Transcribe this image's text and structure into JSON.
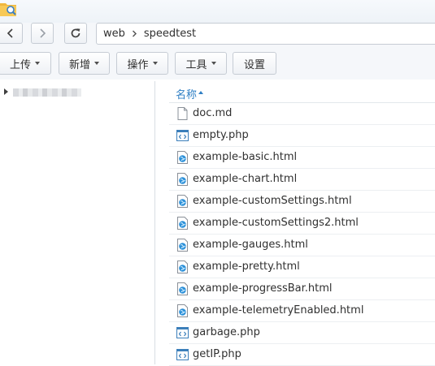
{
  "nav": {
    "path": [
      "web",
      "speedtest"
    ]
  },
  "toolbar": {
    "upload": "上传",
    "new": "新增",
    "action": "操作",
    "tools": "工具",
    "settings": "设置"
  },
  "list": {
    "column_name": "名称",
    "files": [
      {
        "name": "doc.md",
        "type": "document"
      },
      {
        "name": "empty.php",
        "type": "code"
      },
      {
        "name": "example-basic.html",
        "type": "web"
      },
      {
        "name": "example-chart.html",
        "type": "web"
      },
      {
        "name": "example-customSettings.html",
        "type": "web"
      },
      {
        "name": "example-customSettings2.html",
        "type": "web"
      },
      {
        "name": "example-gauges.html",
        "type": "web"
      },
      {
        "name": "example-pretty.html",
        "type": "web"
      },
      {
        "name": "example-progressBar.html",
        "type": "web"
      },
      {
        "name": "example-telemetryEnabled.html",
        "type": "web"
      },
      {
        "name": "garbage.php",
        "type": "code"
      },
      {
        "name": "getIP.php",
        "type": "code"
      }
    ]
  },
  "colors": {
    "accent": "#2f7fc4",
    "folder": "#f0b73c"
  }
}
